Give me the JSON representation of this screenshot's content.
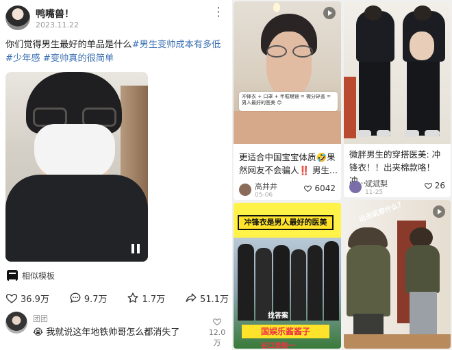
{
  "post": {
    "author": "鸭嘴兽！",
    "date": "2023.11.22",
    "caption_text": "你们觉得男生最好的单品是什么",
    "tags": [
      "#男生变帅成本有多低",
      "#少年感",
      "#变帅真的很简单"
    ],
    "template_label": "相似模板",
    "actions": {
      "likes": "36.9万",
      "comments": "9.7万",
      "favorites": "1.7万",
      "shares": "51.1万"
    },
    "comment": {
      "user": "团团",
      "emoji": "😭",
      "text": "我就说这年地铁帅哥怎么都消失了",
      "likes": "12.0万"
    }
  },
  "feed": [
    {
      "title": "更适合中国宝宝体质🤣果然网友不会骗人‼️ 男生...",
      "overlay_text": "冲锋衣 + 口罩 + 半框眼镜 = 微分碎盖 = 男人最好的医美 😊",
      "user": "高井井",
      "sub": "05-06",
      "likes": "6042"
    },
    {
      "title": "微胖男生的穿搭医美: 冲锋衣！！出夹棉款咯！冲...",
      "user": "斌斌梨",
      "sub": "11-25",
      "likes": "26"
    },
    {
      "banner": "冲锋衣是男人最好的医美",
      "stamp": "找答案",
      "bottom": "国娱乐酱酱子",
      "bottom2": "谷口录制一"
    },
    {
      "speech": "出去玩穿什么？"
    }
  ],
  "colors": {
    "tag": "#3a6fb3",
    "banner_yellow": "#ffe22a",
    "feed_bg": "#f0f0f0"
  }
}
